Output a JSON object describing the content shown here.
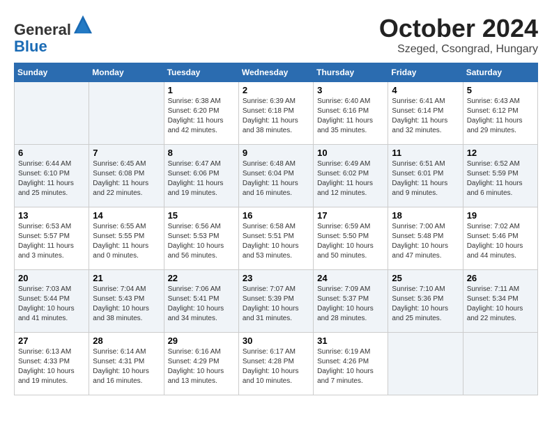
{
  "header": {
    "logo_line1": "General",
    "logo_line2": "Blue",
    "month": "October 2024",
    "location": "Szeged, Csongrad, Hungary"
  },
  "columns": [
    "Sunday",
    "Monday",
    "Tuesday",
    "Wednesday",
    "Thursday",
    "Friday",
    "Saturday"
  ],
  "weeks": [
    [
      {
        "day": "",
        "info": ""
      },
      {
        "day": "",
        "info": ""
      },
      {
        "day": "1",
        "sunrise": "Sunrise: 6:38 AM",
        "sunset": "Sunset: 6:20 PM",
        "daylight": "Daylight: 11 hours and 42 minutes."
      },
      {
        "day": "2",
        "sunrise": "Sunrise: 6:39 AM",
        "sunset": "Sunset: 6:18 PM",
        "daylight": "Daylight: 11 hours and 38 minutes."
      },
      {
        "day": "3",
        "sunrise": "Sunrise: 6:40 AM",
        "sunset": "Sunset: 6:16 PM",
        "daylight": "Daylight: 11 hours and 35 minutes."
      },
      {
        "day": "4",
        "sunrise": "Sunrise: 6:41 AM",
        "sunset": "Sunset: 6:14 PM",
        "daylight": "Daylight: 11 hours and 32 minutes."
      },
      {
        "day": "5",
        "sunrise": "Sunrise: 6:43 AM",
        "sunset": "Sunset: 6:12 PM",
        "daylight": "Daylight: 11 hours and 29 minutes."
      }
    ],
    [
      {
        "day": "6",
        "sunrise": "Sunrise: 6:44 AM",
        "sunset": "Sunset: 6:10 PM",
        "daylight": "Daylight: 11 hours and 25 minutes."
      },
      {
        "day": "7",
        "sunrise": "Sunrise: 6:45 AM",
        "sunset": "Sunset: 6:08 PM",
        "daylight": "Daylight: 11 hours and 22 minutes."
      },
      {
        "day": "8",
        "sunrise": "Sunrise: 6:47 AM",
        "sunset": "Sunset: 6:06 PM",
        "daylight": "Daylight: 11 hours and 19 minutes."
      },
      {
        "day": "9",
        "sunrise": "Sunrise: 6:48 AM",
        "sunset": "Sunset: 6:04 PM",
        "daylight": "Daylight: 11 hours and 16 minutes."
      },
      {
        "day": "10",
        "sunrise": "Sunrise: 6:49 AM",
        "sunset": "Sunset: 6:02 PM",
        "daylight": "Daylight: 11 hours and 12 minutes."
      },
      {
        "day": "11",
        "sunrise": "Sunrise: 6:51 AM",
        "sunset": "Sunset: 6:01 PM",
        "daylight": "Daylight: 11 hours and 9 minutes."
      },
      {
        "day": "12",
        "sunrise": "Sunrise: 6:52 AM",
        "sunset": "Sunset: 5:59 PM",
        "daylight": "Daylight: 11 hours and 6 minutes."
      }
    ],
    [
      {
        "day": "13",
        "sunrise": "Sunrise: 6:53 AM",
        "sunset": "Sunset: 5:57 PM",
        "daylight": "Daylight: 11 hours and 3 minutes."
      },
      {
        "day": "14",
        "sunrise": "Sunrise: 6:55 AM",
        "sunset": "Sunset: 5:55 PM",
        "daylight": "Daylight: 11 hours and 0 minutes."
      },
      {
        "day": "15",
        "sunrise": "Sunrise: 6:56 AM",
        "sunset": "Sunset: 5:53 PM",
        "daylight": "Daylight: 10 hours and 56 minutes."
      },
      {
        "day": "16",
        "sunrise": "Sunrise: 6:58 AM",
        "sunset": "Sunset: 5:51 PM",
        "daylight": "Daylight: 10 hours and 53 minutes."
      },
      {
        "day": "17",
        "sunrise": "Sunrise: 6:59 AM",
        "sunset": "Sunset: 5:50 PM",
        "daylight": "Daylight: 10 hours and 50 minutes."
      },
      {
        "day": "18",
        "sunrise": "Sunrise: 7:00 AM",
        "sunset": "Sunset: 5:48 PM",
        "daylight": "Daylight: 10 hours and 47 minutes."
      },
      {
        "day": "19",
        "sunrise": "Sunrise: 7:02 AM",
        "sunset": "Sunset: 5:46 PM",
        "daylight": "Daylight: 10 hours and 44 minutes."
      }
    ],
    [
      {
        "day": "20",
        "sunrise": "Sunrise: 7:03 AM",
        "sunset": "Sunset: 5:44 PM",
        "daylight": "Daylight: 10 hours and 41 minutes."
      },
      {
        "day": "21",
        "sunrise": "Sunrise: 7:04 AM",
        "sunset": "Sunset: 5:43 PM",
        "daylight": "Daylight: 10 hours and 38 minutes."
      },
      {
        "day": "22",
        "sunrise": "Sunrise: 7:06 AM",
        "sunset": "Sunset: 5:41 PM",
        "daylight": "Daylight: 10 hours and 34 minutes."
      },
      {
        "day": "23",
        "sunrise": "Sunrise: 7:07 AM",
        "sunset": "Sunset: 5:39 PM",
        "daylight": "Daylight: 10 hours and 31 minutes."
      },
      {
        "day": "24",
        "sunrise": "Sunrise: 7:09 AM",
        "sunset": "Sunset: 5:37 PM",
        "daylight": "Daylight: 10 hours and 28 minutes."
      },
      {
        "day": "25",
        "sunrise": "Sunrise: 7:10 AM",
        "sunset": "Sunset: 5:36 PM",
        "daylight": "Daylight: 10 hours and 25 minutes."
      },
      {
        "day": "26",
        "sunrise": "Sunrise: 7:11 AM",
        "sunset": "Sunset: 5:34 PM",
        "daylight": "Daylight: 10 hours and 22 minutes."
      }
    ],
    [
      {
        "day": "27",
        "sunrise": "Sunrise: 6:13 AM",
        "sunset": "Sunset: 4:33 PM",
        "daylight": "Daylight: 10 hours and 19 minutes."
      },
      {
        "day": "28",
        "sunrise": "Sunrise: 6:14 AM",
        "sunset": "Sunset: 4:31 PM",
        "daylight": "Daylight: 10 hours and 16 minutes."
      },
      {
        "day": "29",
        "sunrise": "Sunrise: 6:16 AM",
        "sunset": "Sunset: 4:29 PM",
        "daylight": "Daylight: 10 hours and 13 minutes."
      },
      {
        "day": "30",
        "sunrise": "Sunrise: 6:17 AM",
        "sunset": "Sunset: 4:28 PM",
        "daylight": "Daylight: 10 hours and 10 minutes."
      },
      {
        "day": "31",
        "sunrise": "Sunrise: 6:19 AM",
        "sunset": "Sunset: 4:26 PM",
        "daylight": "Daylight: 10 hours and 7 minutes."
      },
      {
        "day": "",
        "info": ""
      },
      {
        "day": "",
        "info": ""
      }
    ]
  ]
}
